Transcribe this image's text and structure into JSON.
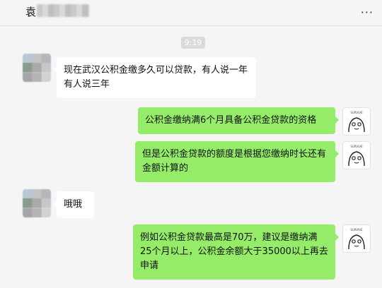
{
  "header": {
    "title_char": "袁",
    "more_label": "···"
  },
  "time_label": "9:19",
  "messages": [
    {
      "side": "left",
      "text": "现在武汉公积金缴多久可以贷款，有人说一年有人说三年"
    },
    {
      "side": "right",
      "text": "公积金缴纳满6个月具备公积金贷款的资格"
    },
    {
      "side": "right",
      "text": "但是公积金贷款的额度是根据您缴纳时长还有金额计算的"
    },
    {
      "side": "left",
      "text": "哦哦"
    },
    {
      "side": "right",
      "text": "例如公积金贷款最高是70万，建议是缴纳满25个月以上，公积金余额大于35000以上再去申请"
    }
  ],
  "colors": {
    "self_bubble": "#95ec69",
    "other_bubble": "#ffffff",
    "background": "#f5f5f5"
  }
}
